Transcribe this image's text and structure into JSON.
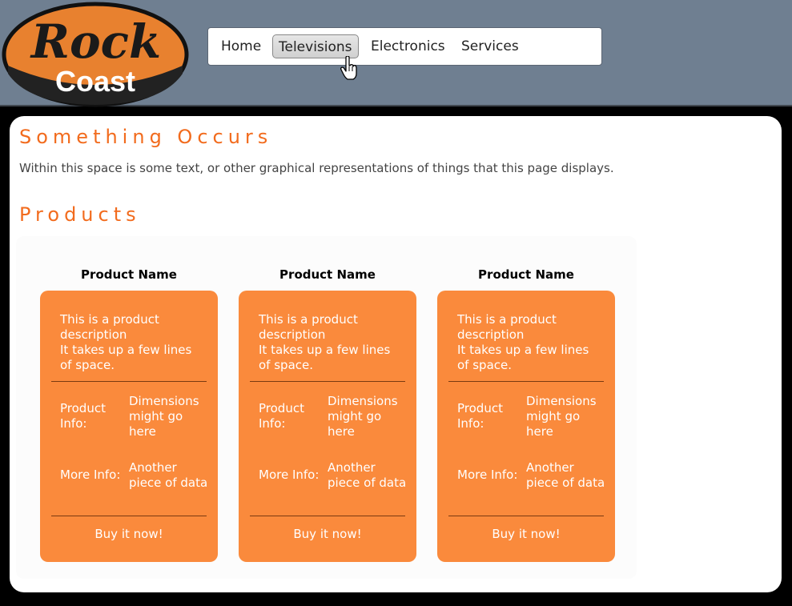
{
  "logo": {
    "line1": "Rock",
    "line2": "Coast"
  },
  "nav": {
    "items": [
      {
        "label": "Home"
      },
      {
        "label": "Televisions"
      },
      {
        "label": "Electronics"
      },
      {
        "label": "Services"
      }
    ],
    "active": "Televisions"
  },
  "main": {
    "heading": "Something Occurs",
    "intro": "Within this space is some text, or other graphical representations of things that this page displays.",
    "products_heading": "Products"
  },
  "products": [
    {
      "name": "Product Name",
      "desc1": "This is a product description",
      "desc2": "It takes up a few lines of space.",
      "info1_label": "Product Info:",
      "info1_value": "Dimensions might go here",
      "info2_label": "More Info:",
      "info2_value": "Another piece of data",
      "buy_label": "Buy it now!"
    },
    {
      "name": "Product Name",
      "desc1": "This is a product description",
      "desc2": "It takes up a few lines of space.",
      "info1_label": "Product Info:",
      "info1_value": "Dimensions might go here",
      "info2_label": "More Info:",
      "info2_value": "Another piece of data",
      "buy_label": "Buy it now!"
    },
    {
      "name": "Product Name",
      "desc1": "This is a product description",
      "desc2": "It takes up a few lines of space.",
      "info1_label": "Product Info:",
      "info1_value": "Dimensions might go here",
      "info2_label": "More Info:",
      "info2_value": "Another piece of data",
      "buy_label": "Buy it now!"
    }
  ],
  "colors": {
    "header_bg": "#6f7f91",
    "accent": "#f26b1d",
    "card_bg": "#fa8a3c",
    "logo_orange": "#e8812f"
  },
  "icons": {
    "cursor": "hand-pointer-icon"
  }
}
